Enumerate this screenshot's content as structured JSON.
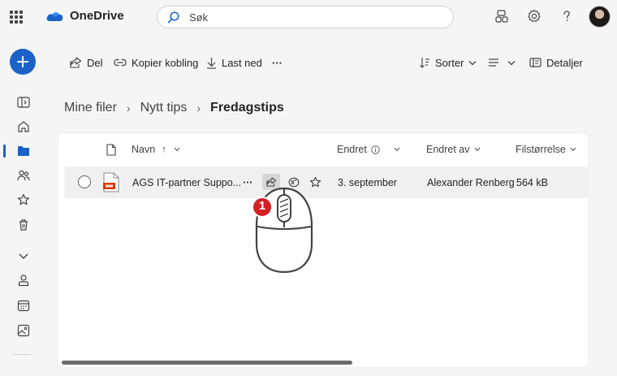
{
  "app": {
    "brand": "OneDrive",
    "accent": "#1a62c7"
  },
  "search": {
    "placeholder": "Søk"
  },
  "toolbar": {
    "share_label": "Del",
    "copy_link_label": "Kopier kobling",
    "download_label": "Last ned",
    "more_label": "···",
    "sort_label": "Sorter",
    "details_label": "Detaljer"
  },
  "breadcrumb": {
    "items": [
      "Mine filer",
      "Nytt tips",
      "Fredagstips"
    ]
  },
  "table": {
    "columns": {
      "name": "Navn",
      "modified": "Endret",
      "modified_by": "Endret av",
      "size": "Filstørrelse"
    },
    "sort_arrow": "↑",
    "rows": [
      {
        "name": "AGS IT-partner Suppo...",
        "more": "···",
        "modified": "3. september",
        "modified_by": "Alexander Renberg",
        "size": "564 kB"
      }
    ]
  },
  "annotation": {
    "step": "1"
  },
  "icons": [
    "waffle-icon",
    "onedrive-cloud-icon",
    "search-icon",
    "share-people-icon",
    "settings-icon",
    "help-icon",
    "avatar",
    "plus-icon"
  ]
}
